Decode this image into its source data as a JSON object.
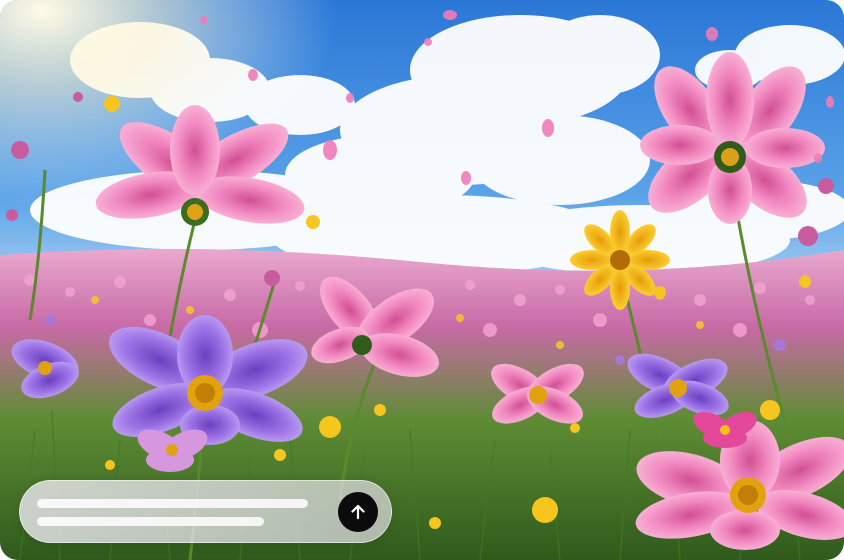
{
  "hero": {
    "scene_description_icon": "flower-field-photo",
    "colors": {
      "sky_top": "#2f7fd9",
      "sky_mid": "#6fb0ec",
      "cloud": "#ffffff",
      "pink_flower": "#f07bb8",
      "violet_flower": "#8a63d8",
      "yellow_flower": "#f7c21c",
      "grass": "#4a8a2a"
    }
  },
  "composer": {
    "placeholder_lines": 2,
    "send_icon": "arrow-up-icon",
    "send_button_color": "#0b0b0c"
  }
}
